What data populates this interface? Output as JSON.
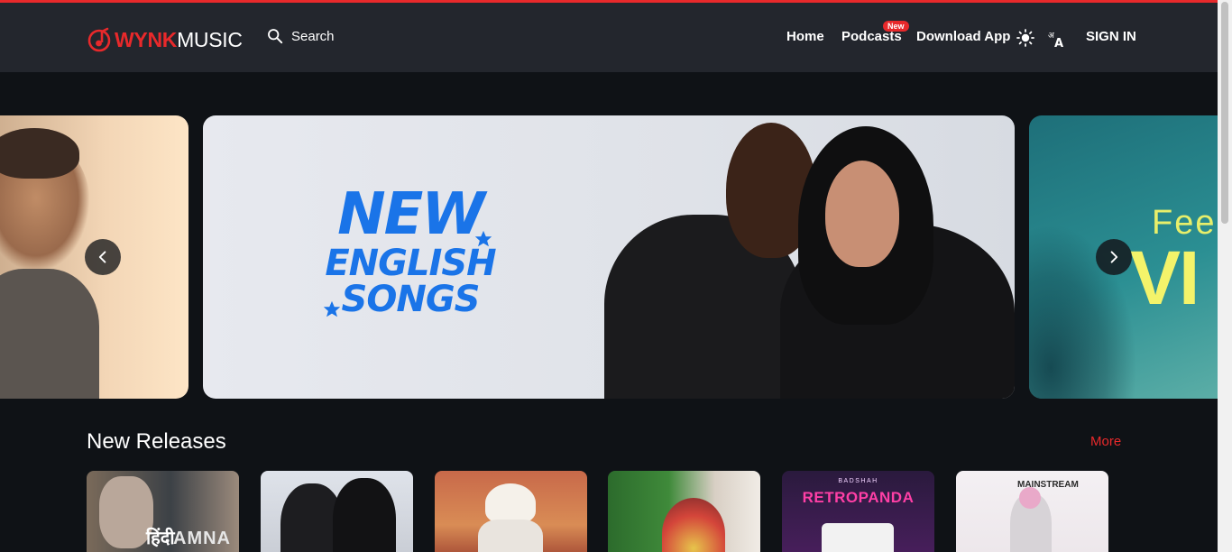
{
  "header": {
    "logo_strong": "WYNK",
    "logo_light": "MUSIC",
    "search_label": "Search",
    "nav": {
      "home": "Home",
      "podcasts": "Podcasts",
      "podcasts_badge": "New",
      "download": "Download App",
      "signin": "SIGN IN"
    },
    "icons": [
      "search-icon",
      "sun-icon",
      "language-icon"
    ]
  },
  "carousel": {
    "banners": [
      {
        "name": "banner-previous",
        "text": ""
      },
      {
        "name": "banner-new-english-songs",
        "lines": [
          "NEW",
          "ENGLISH",
          "SONGS"
        ]
      },
      {
        "name": "banner-next",
        "line1": "Fee",
        "line2": "VI"
      }
    ]
  },
  "new_releases": {
    "title": "New Releases",
    "more_label": "More",
    "tiles": [
      {
        "text_a": "हिंदी",
        "text_b": "AMNA"
      },
      {
        "text_a": ""
      },
      {
        "text_a": ""
      },
      {
        "text_a": ""
      },
      {
        "text_top": "BADSHAH",
        "text_a": "RETROPANDA"
      },
      {
        "text_a": "MAINSTREAM"
      }
    ]
  },
  "colors": {
    "accent": "#e8292b",
    "header_bg": "#23262d",
    "page_bg": "#0f1216",
    "banner_blue": "#1a74e8"
  }
}
